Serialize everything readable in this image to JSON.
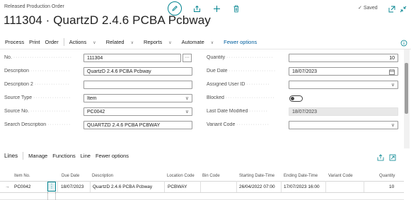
{
  "header": {
    "caption": "Released Production Order",
    "title": "111304 · QuartzD 2.4.6 PCBA Pcbway",
    "saved": "Saved"
  },
  "actions": {
    "process": "Process",
    "print": "Print",
    "order": "Order",
    "actions": "Actions",
    "related": "Related",
    "reports": "Reports",
    "automate": "Automate",
    "fewer": "Fewer options"
  },
  "fields": {
    "no": {
      "label": "No.",
      "value": "111304"
    },
    "description": {
      "label": "Description",
      "value": "QuartzD 2.4.6 PCBA Pcbway"
    },
    "description2": {
      "label": "Description 2",
      "value": ""
    },
    "source_type": {
      "label": "Source Type",
      "value": "Item"
    },
    "source_no": {
      "label": "Source No.",
      "value": "PC0042"
    },
    "search_description": {
      "label": "Search Description",
      "value": "QUARTZD 2.4.6 PCBA PCBWAY"
    },
    "quantity": {
      "label": "Quantity",
      "value": "10"
    },
    "due_date": {
      "label": "Due Date",
      "value": "18/07/2023"
    },
    "assigned_user": {
      "label": "Assigned User ID",
      "value": ""
    },
    "blocked": {
      "label": "Blocked"
    },
    "last_modified": {
      "label": "Last Date Modified",
      "value": "18/07/2023"
    },
    "variant_code": {
      "label": "Variant Code",
      "value": ""
    }
  },
  "lines": {
    "title": "Lines",
    "manage": "Manage",
    "functions": "Functions",
    "line": "Line",
    "fewer": "Fewer options",
    "columns": [
      "Item No.",
      "Due Date",
      "Description",
      "Location Code",
      "Bin Code",
      "Starting Date-Time",
      "Ending Date-Time",
      "Variant Code",
      "Quantity"
    ],
    "row": {
      "item_no": "PC0042",
      "due_date": "18/07/2023",
      "description": "QuartzD 2.4.6 PCBA Pcbway",
      "location": "PCBWAY",
      "bin": "",
      "start": "26/04/2022 07:00",
      "end": "17/07/2023 16:00",
      "variant": "",
      "quantity": "10"
    }
  },
  "colors": {
    "accent": "#00838f",
    "link": "#005f9e"
  }
}
